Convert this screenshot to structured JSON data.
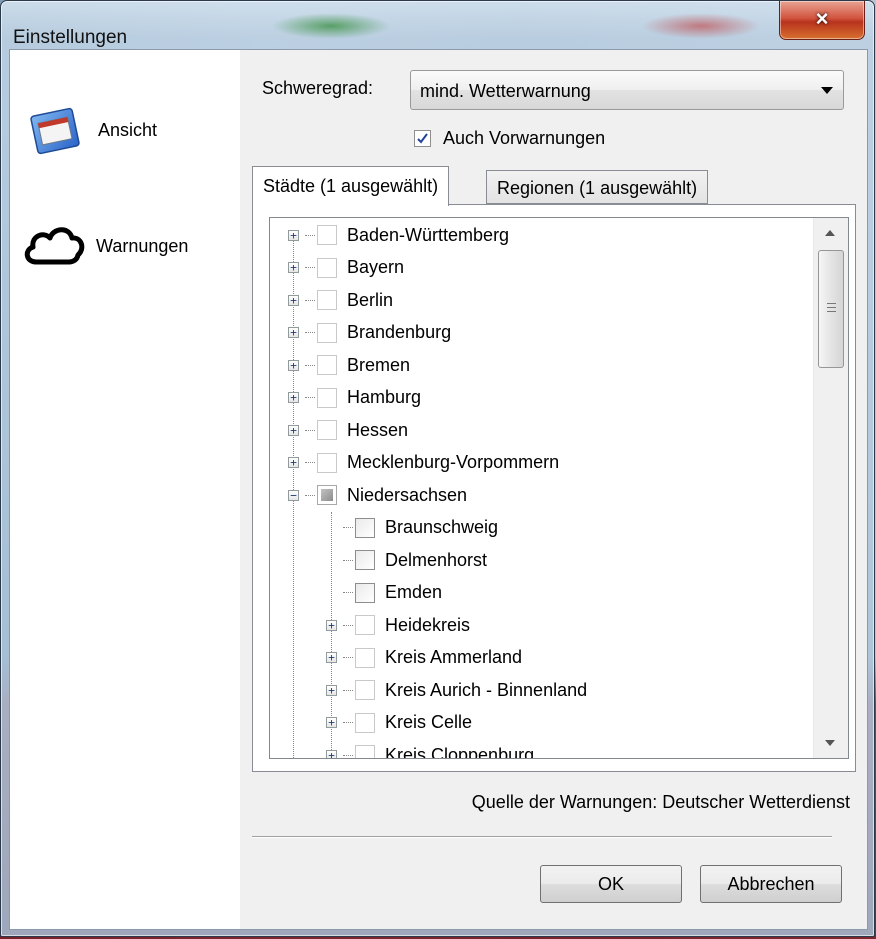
{
  "window": {
    "title": "Einstellungen",
    "close_glyph": "×"
  },
  "sidebar": {
    "items": [
      {
        "label": "Ansicht",
        "icon": "window-icon"
      },
      {
        "label": "Warnungen",
        "icon": "cloud-icon"
      }
    ]
  },
  "severity": {
    "label": "Schweregrad:",
    "selected": "mind. Wetterwarnung"
  },
  "prewarnings": {
    "label": "Auch Vorwarnungen",
    "checked": true
  },
  "tabs": [
    {
      "label": "Städte (1 ausgewählt)",
      "active": true
    },
    {
      "label": "Regionen (1 ausgewählt)",
      "active": false
    }
  ],
  "tree": {
    "items": [
      {
        "label": "Baden-Württemberg",
        "level": 0,
        "expander": "+",
        "check": "empty"
      },
      {
        "label": "Bayern",
        "level": 0,
        "expander": "+",
        "check": "empty"
      },
      {
        "label": "Berlin",
        "level": 0,
        "expander": "+",
        "check": "empty"
      },
      {
        "label": "Brandenburg",
        "level": 0,
        "expander": "+",
        "check": "empty"
      },
      {
        "label": "Bremen",
        "level": 0,
        "expander": "+",
        "check": "empty"
      },
      {
        "label": "Hamburg",
        "level": 0,
        "expander": "+",
        "check": "empty"
      },
      {
        "label": "Hessen",
        "level": 0,
        "expander": "+",
        "check": "empty"
      },
      {
        "label": "Mecklenburg-Vorpommern",
        "level": 0,
        "expander": "+",
        "check": "empty"
      },
      {
        "label": "Niedersachsen",
        "level": 0,
        "expander": "-",
        "check": "partial"
      },
      {
        "label": "Braunschweig",
        "level": 1,
        "expander": "",
        "check": "child"
      },
      {
        "label": "Delmenhorst",
        "level": 1,
        "expander": "",
        "check": "child"
      },
      {
        "label": "Emden",
        "level": 1,
        "expander": "",
        "check": "child"
      },
      {
        "label": "Heidekreis",
        "level": 1,
        "expander": "+",
        "check": "empty"
      },
      {
        "label": "Kreis Ammerland",
        "level": 1,
        "expander": "+",
        "check": "empty"
      },
      {
        "label": "Kreis Aurich - Binnenland",
        "level": 1,
        "expander": "+",
        "check": "empty"
      },
      {
        "label": "Kreis Celle",
        "level": 1,
        "expander": "+",
        "check": "empty"
      },
      {
        "label": "Kreis Cloppenburg",
        "level": 1,
        "expander": "+",
        "check": "empty"
      }
    ]
  },
  "source_text": "Quelle der Warnungen: Deutscher Wetterdienst",
  "buttons": {
    "ok": "OK",
    "cancel": "Abbrechen"
  }
}
